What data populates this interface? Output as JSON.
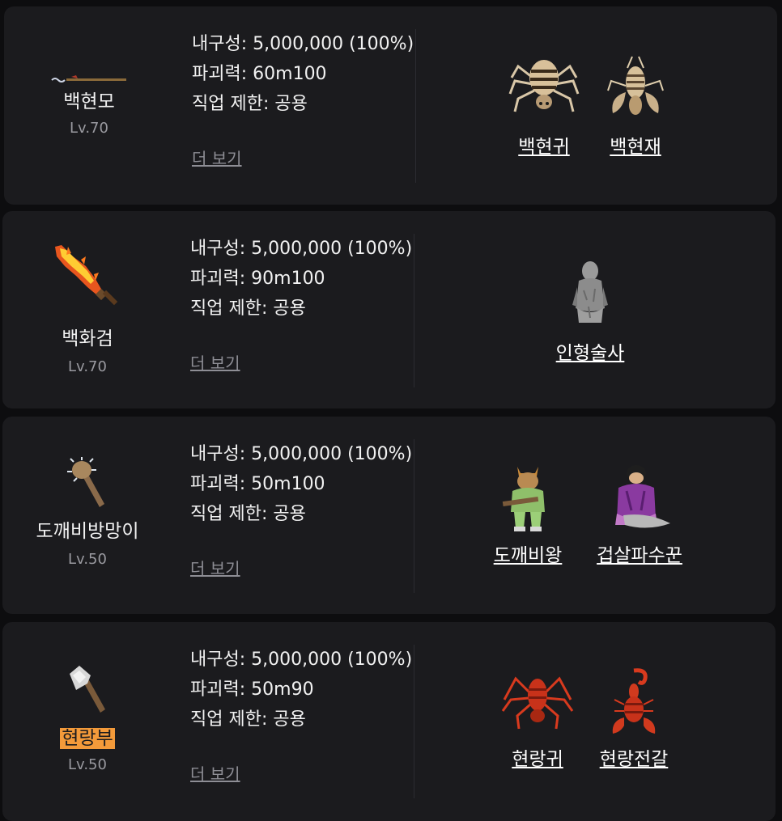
{
  "common": {
    "durability_label": "내구성: ",
    "power_label": "파괴력: ",
    "job_label": "직업 제한: ",
    "more_link": "더 보기"
  },
  "items": [
    {
      "name": "백현모",
      "level": "Lv.70",
      "durability": "5,000,000 (100%)",
      "power": "60m100",
      "job": "공용",
      "icon": "spear-icon",
      "drops": [
        {
          "name": "백현귀",
          "icon": "striped-spider-icon"
        },
        {
          "name": "백현재",
          "icon": "lobster-icon"
        }
      ]
    },
    {
      "name": "백화검",
      "level": "Lv.70",
      "durability": "5,000,000 (100%)",
      "power": "90m100",
      "job": "공용",
      "icon": "flame-sword-icon",
      "drops": [
        {
          "name": "인형술사",
          "icon": "stone-statue-icon"
        }
      ]
    },
    {
      "name": "도깨비방망이",
      "level": "Lv.50",
      "durability": "5,000,000 (100%)",
      "power": "50m100",
      "job": "공용",
      "icon": "spiked-club-icon",
      "drops": [
        {
          "name": "도깨비왕",
          "icon": "goblin-king-icon"
        },
        {
          "name": "겁살파수꾼",
          "icon": "purple-bandit-icon"
        }
      ]
    },
    {
      "name": "현랑부",
      "level": "Lv.50",
      "durability": "5,000,000 (100%)",
      "power": "50m90",
      "job": "공용",
      "icon": "axe-icon",
      "highlight_color": "#f39a3a",
      "drops": [
        {
          "name": "현랑귀",
          "icon": "red-spider-icon"
        },
        {
          "name": "현랑전갈",
          "icon": "red-scorpion-icon"
        }
      ]
    }
  ]
}
